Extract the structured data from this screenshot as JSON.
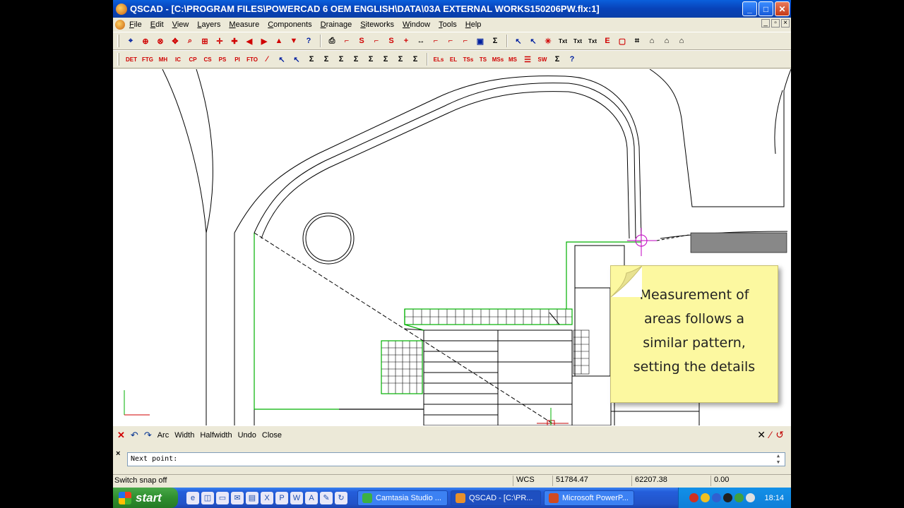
{
  "window": {
    "title": "QSCAD - [C:\\PROGRAM FILES\\POWERCAD 6 OEM ENGLISH\\DATA\\03A EXTERNAL WORKS150206PW.flx:1]",
    "minimize": "_",
    "maximize": "□",
    "close": "✕"
  },
  "menu": [
    {
      "label": "File",
      "u": "F",
      "rest": "ile"
    },
    {
      "label": "Edit",
      "u": "E",
      "rest": "dit"
    },
    {
      "label": "View",
      "u": "V",
      "rest": "iew"
    },
    {
      "label": "Layers",
      "u": "L",
      "rest": "ayers"
    },
    {
      "label": "Measure",
      "u": "M",
      "rest": "easure"
    },
    {
      "label": "Components",
      "u": "C",
      "rest": "omponents"
    },
    {
      "label": "Drainage",
      "u": "D",
      "rest": "rainage"
    },
    {
      "label": "Siteworks",
      "u": "S",
      "rest": "iteworks"
    },
    {
      "label": "Window",
      "u": "W",
      "rest": "indow"
    },
    {
      "label": "Tools",
      "u": "T",
      "rest": "ools"
    },
    {
      "label": "Help",
      "u": "H",
      "rest": "elp"
    }
  ],
  "toolbar2_labels": {
    "det": "DET",
    "ftg": "FTG",
    "mh": "MH",
    "ic": "IC",
    "cp": "CP",
    "cs": "CS",
    "ps": "PS",
    "pi": "PI",
    "fto": "FTO",
    "els": "ELs",
    "el": "EL",
    "tss": "TSs",
    "ts": "TS",
    "mss": "MSs",
    "ms": "MS",
    "sw": "SW"
  },
  "note": {
    "lines": [
      "Measurement of",
      "areas follows a",
      "similar pattern,",
      "setting the details"
    ],
    "background": "#fcf8a0"
  },
  "command_bar": {
    "arc": "Arc",
    "width": "Width",
    "halfwidth": "Halfwidth",
    "undo": "Undo",
    "close": "Close"
  },
  "prompt": {
    "text": "Next point:"
  },
  "status": {
    "message": "Switch snap off",
    "coord_system": "WCS",
    "x": "51784.47",
    "y": "62207.38",
    "z": "0.00"
  },
  "taskbar": {
    "start": "start",
    "tasks": [
      {
        "label": "Camtasia Studio ...",
        "color": "#3cb043"
      },
      {
        "label": "QSCAD - [C:\\PR...",
        "color": "#e8902a"
      },
      {
        "label": "Microsoft PowerP...",
        "color": "#d04a20"
      }
    ],
    "clock": "18:14"
  },
  "colors": {
    "accent_green": "#00b000",
    "crosshair": "#c000c0",
    "tool_red": "#d00000",
    "tool_blue": "#0020a0"
  }
}
